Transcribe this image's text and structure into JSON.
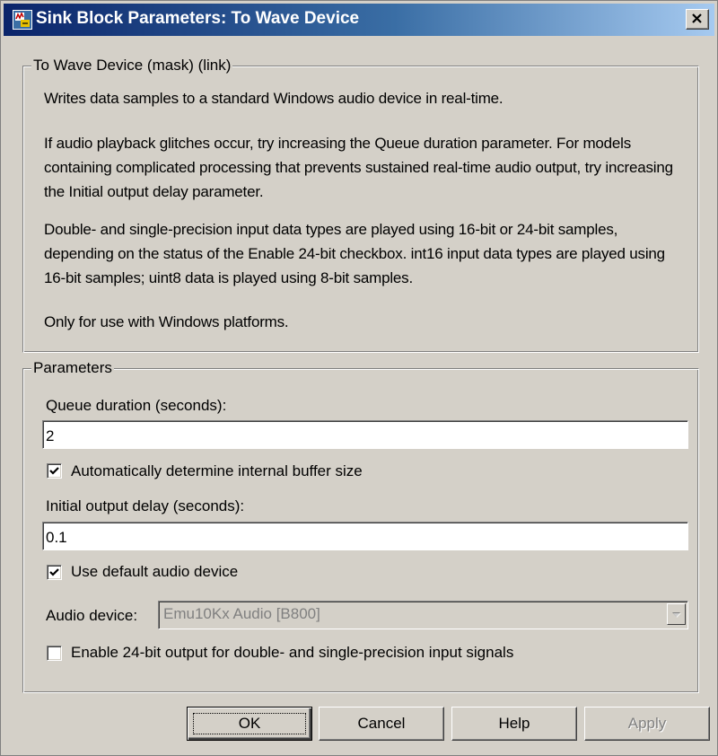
{
  "window": {
    "title": "Sink Block Parameters: To Wave Device",
    "icon": "simulink-block-icon",
    "close_icon": "close-icon"
  },
  "description_group": {
    "title": "To Wave Device (mask) (link)",
    "paragraphs": [
      "Writes data samples to a standard Windows audio device in real-time.",
      "If audio playback glitches occur, try increasing the Queue duration parameter.  For models containing complicated processing that prevents sustained real-time audio output, try increasing the Initial output delay parameter.",
      "Double- and single-precision input data types are played using 16-bit or 24-bit samples, depending on the status of the Enable 24-bit checkbox.  int16 input data types are played using 16-bit samples; uint8 data is played using 8-bit samples.",
      "Only for use with Windows platforms."
    ]
  },
  "parameters_group": {
    "title": "Parameters",
    "queue_duration": {
      "label": "Queue duration (seconds):",
      "value": "2"
    },
    "auto_buffer": {
      "label": "Automatically determine internal buffer size",
      "checked": true
    },
    "initial_delay": {
      "label": "Initial output delay (seconds):",
      "value": "0.1"
    },
    "default_device": {
      "label": "Use default audio device",
      "checked": true
    },
    "audio_device": {
      "label": "Audio device:",
      "selected": "Emu10Kx Audio [B800]",
      "enabled": false
    },
    "enable_24bit": {
      "label": "Enable 24-bit output for double- and single-precision input signals",
      "checked": false
    }
  },
  "buttons": {
    "ok": "OK",
    "cancel": "Cancel",
    "help": "Help",
    "apply": "Apply"
  },
  "colors": {
    "face": "#d4d0c8",
    "title_gradient_start": "#0a246a",
    "title_gradient_end": "#a6caf0",
    "disabled_text": "#808080"
  }
}
